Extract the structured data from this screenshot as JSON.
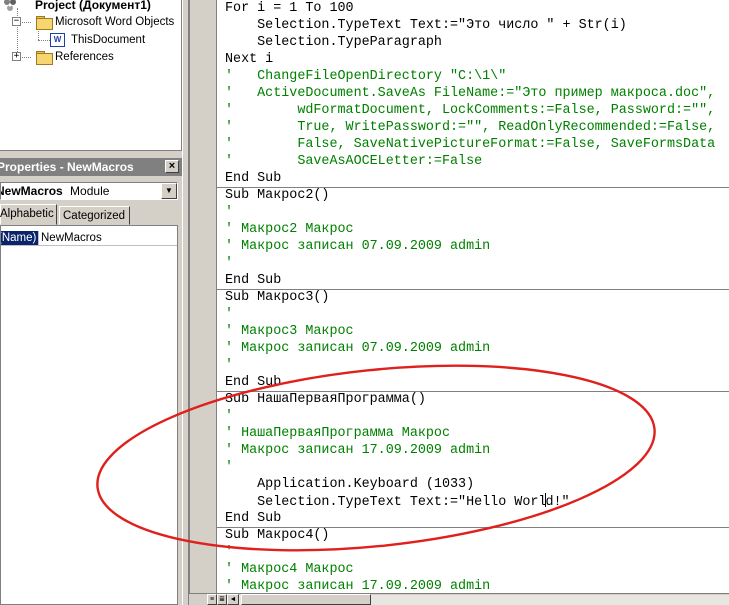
{
  "project_tree": {
    "root_label": "Project (Документ1)",
    "folder_label": "Microsoft Word Objects",
    "document_label": "ThisDocument",
    "references_label": "References"
  },
  "properties": {
    "title": "Properties - NewMacros",
    "object_name": "NewMacros",
    "object_type": "Module",
    "tab_alphabetic": "Alphabetic",
    "tab_categorized": "Categorized",
    "row_name": "(Name)",
    "row_value": "NewMacros"
  },
  "code_lines": [
    {
      "text": "For i = 1 To 100",
      "comment": false
    },
    {
      "text": "    Selection.TypeText Text:=\"Это число \" + Str(i)",
      "comment": false
    },
    {
      "text": "    Selection.TypeParagraph",
      "comment": false
    },
    {
      "text": "Next i",
      "comment": false
    },
    {
      "text": "'   ChangeFileOpenDirectory \"C:\\1\\\"",
      "comment": true
    },
    {
      "text": "'   ActiveDocument.SaveAs FileName:=\"Это пример макроса.doc\",",
      "comment": true
    },
    {
      "text": "'        wdFormatDocument, LockComments:=False, Password:=\"\",",
      "comment": true
    },
    {
      "text": "'        True, WritePassword:=\"\", ReadOnlyRecommended:=False,",
      "comment": true
    },
    {
      "text": "'        False, SaveNativePictureFormat:=False, SaveFormsData",
      "comment": true
    },
    {
      "text": "'        SaveAsAOCELetter:=False",
      "comment": true
    },
    {
      "text": "End Sub",
      "comment": false
    },
    {
      "text": "Sub Макрос2()",
      "comment": false
    },
    {
      "text": "'",
      "comment": true
    },
    {
      "text": "' Макрос2 Макрос",
      "comment": true
    },
    {
      "text": "' Макрос записан 07.09.2009 admin",
      "comment": true
    },
    {
      "text": "'",
      "comment": true
    },
    {
      "text": "End Sub",
      "comment": false
    },
    {
      "text": "Sub Макрос3()",
      "comment": false
    },
    {
      "text": "'",
      "comment": true
    },
    {
      "text": "' Макрос3 Макрос",
      "comment": true
    },
    {
      "text": "' Макрос записан 07.09.2009 admin",
      "comment": true
    },
    {
      "text": "'",
      "comment": true
    },
    {
      "text": "End Sub",
      "comment": false
    },
    {
      "text": "Sub НашаПерваяПрограмма()",
      "comment": false
    },
    {
      "text": "'",
      "comment": true
    },
    {
      "text": "' НашаПерваяПрограмма Макрос",
      "comment": true
    },
    {
      "text": "' Макрос записан 17.09.2009 admin",
      "comment": true
    },
    {
      "text": "'",
      "comment": true
    },
    {
      "text": "    Application.Keyboard (1033)",
      "comment": false
    },
    {
      "text": "    Selection.TypeText Text:=\"Hello World!\"",
      "comment": false
    },
    {
      "text": "End Sub",
      "comment": false
    },
    {
      "text": "Sub Макрос4()",
      "comment": false
    },
    {
      "text": "'",
      "comment": true
    },
    {
      "text": "' Макрос4 Макрос",
      "comment": true
    },
    {
      "text": "' Макрос записан 17.09.2009 admin",
      "comment": true
    }
  ],
  "procedure_separator_after_lines": [
    10,
    16,
    22,
    30
  ],
  "colors": {
    "comment": "#008000",
    "annotation": "#e0201c",
    "selection": "#0a246a"
  }
}
